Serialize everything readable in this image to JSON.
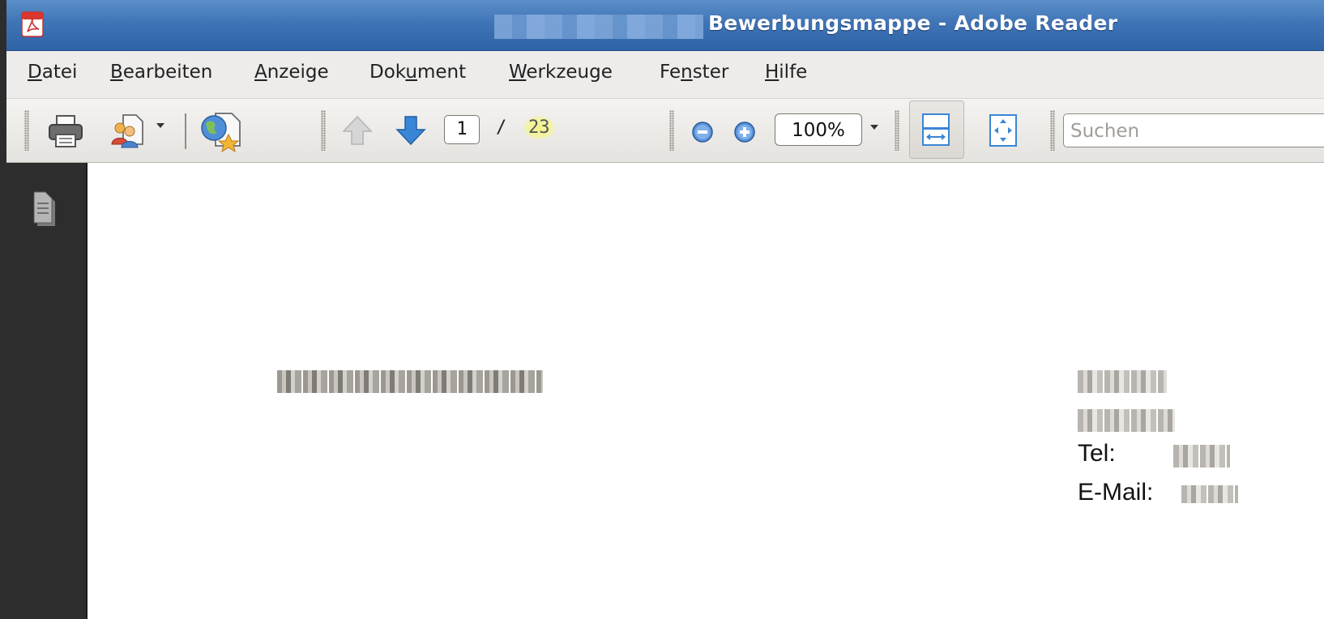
{
  "titlebar": {
    "title": "Bewerbungsmappe - Adobe Reader"
  },
  "menu": [
    {
      "prefix": "",
      "accel": "D",
      "rest": "atei"
    },
    {
      "prefix": "",
      "accel": "B",
      "rest": "earbeiten"
    },
    {
      "prefix": "",
      "accel": "A",
      "rest": "nzeige"
    },
    {
      "prefix": "Dok",
      "accel": "u",
      "rest": "ment"
    },
    {
      "prefix": "",
      "accel": "W",
      "rest": "erkzeuge"
    },
    {
      "prefix": "Fe",
      "accel": "n",
      "rest": "ster"
    },
    {
      "prefix": "",
      "accel": "H",
      "rest": "ilfe"
    }
  ],
  "toolbar": {
    "current_page": "1",
    "page_separator": "/",
    "total_pages": "23",
    "zoom": "100%",
    "search_placeholder": "Suchen"
  },
  "icons": [
    "pdf-app-icon",
    "print-icon",
    "collaborate-icon",
    "dropdown-arrow-icon",
    "secure-document-icon",
    "previous-page-icon",
    "next-page-icon",
    "zoom-out-icon",
    "zoom-in-icon",
    "fit-width-icon",
    "fit-page-icon",
    "pages-panel-icon"
  ],
  "document": {
    "tel_label": "Tel:",
    "email_label": "E-Mail:"
  },
  "colors": {
    "titlebar": "#3f74b6",
    "left_panel": "#2d2d2d",
    "page_total_highlight": "#f3f28a",
    "arrow_blue": "#3a86d6"
  }
}
